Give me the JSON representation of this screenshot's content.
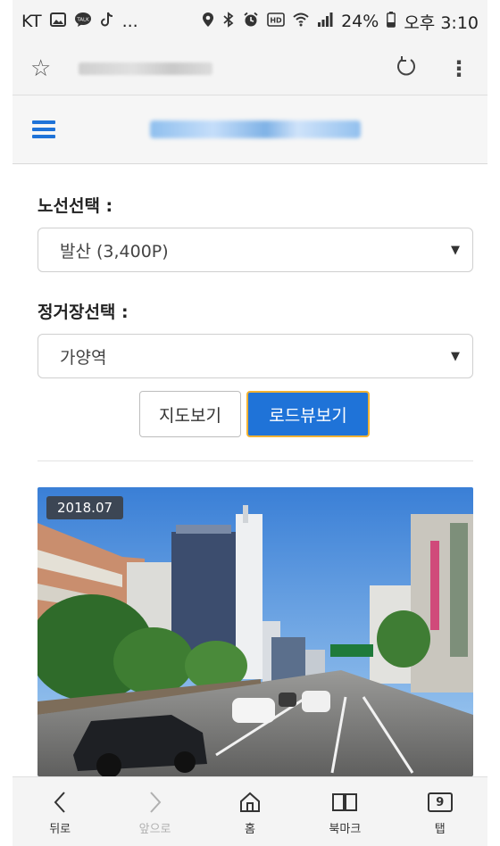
{
  "status_bar": {
    "carrier": "KT",
    "notification_icons": [
      "image-icon",
      "talk-icon",
      "tiktok-icon"
    ],
    "more": "...",
    "system_icons": [
      "location-icon",
      "bluetooth-icon",
      "alarm-icon",
      "hd-icon",
      "wifi-icon",
      "signal-icon"
    ],
    "battery": "24%",
    "time": "오후 3:10"
  },
  "browser": {
    "url_blurred": true
  },
  "site_header": {
    "menu_icon": "hamburger-icon",
    "title_blurred": true,
    "accent_color": "#1f73d8"
  },
  "form": {
    "route_label": "노선선택 :",
    "route_value": "발산 (3,400P)",
    "stop_label": "정거장선택 :",
    "stop_value": "가양역",
    "caret": "▼",
    "map_button": "지도보기",
    "roadview_button": "로드뷰보기"
  },
  "roadview": {
    "date": "2018.07"
  },
  "bottom_nav": {
    "back": "뒤로",
    "forward": "앞으로",
    "home": "홈",
    "bookmark": "북마크",
    "tabs": "탭",
    "tab_count": "9"
  }
}
